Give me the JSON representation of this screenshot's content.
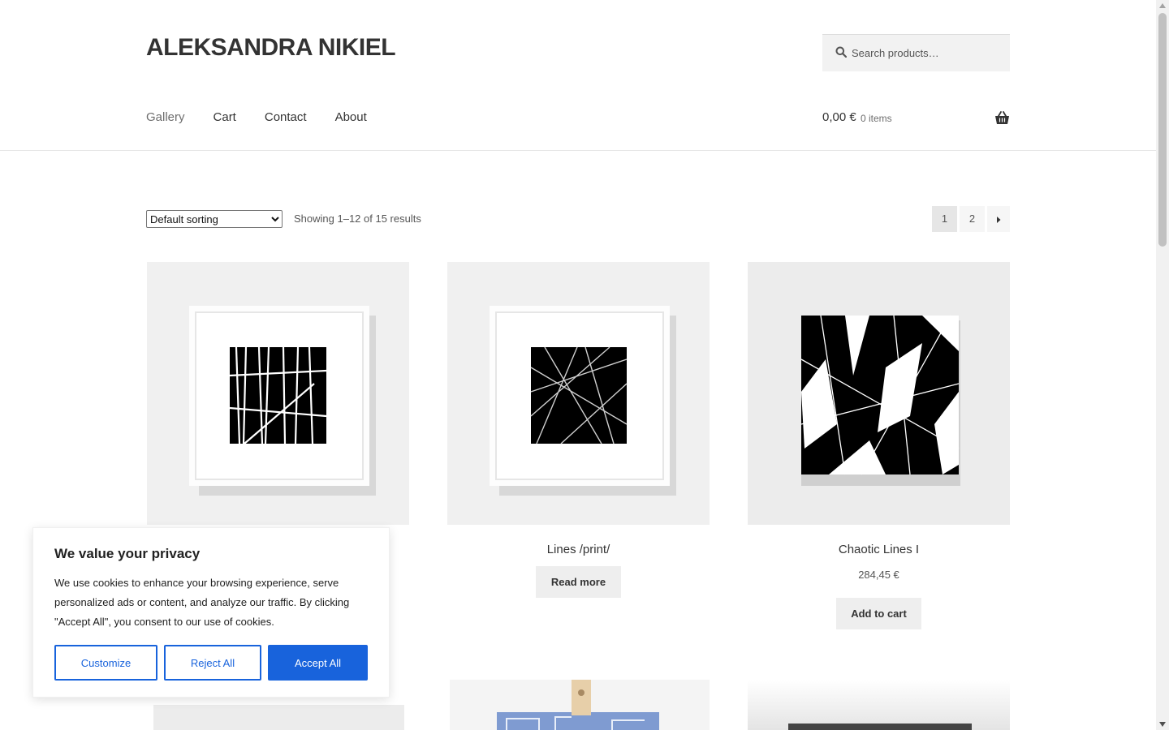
{
  "site": {
    "title": "ALEKSANDRA NIKIEL"
  },
  "search": {
    "placeholder": "Search products…",
    "icon": "search-icon"
  },
  "nav": {
    "items": [
      {
        "label": "Gallery",
        "current": true
      },
      {
        "label": "Cart",
        "current": false
      },
      {
        "label": "Contact",
        "current": false
      },
      {
        "label": "About",
        "current": false
      }
    ]
  },
  "cart": {
    "amount": "0,00 €",
    "count": "0 items",
    "icon": "basket-icon"
  },
  "toolbar": {
    "sorting": {
      "options": [
        "Default sorting"
      ],
      "selected": "Default sorting"
    },
    "result_count": "Showing 1–12 of 15 results",
    "pagination": {
      "pages": [
        "1",
        "2"
      ],
      "current": "1",
      "next_icon": "arrow-right-icon"
    }
  },
  "products": [
    {
      "title": "",
      "button": ""
    },
    {
      "title": "Lines /print/",
      "button": "Read more"
    },
    {
      "title": "Chaotic Lines I",
      "price": "284,45 €",
      "button": "Add to cart"
    }
  ],
  "cookie": {
    "title": "We value your privacy",
    "text": "We use cookies to enhance your browsing experience, serve personalized ads or content, and analyze our traffic. By clicking \"Accept All\", you consent to our use of cookies.",
    "customize": "Customize",
    "reject": "Reject All",
    "accept": "Accept All"
  },
  "colors": {
    "accent": "#1863dc",
    "text": "#333333",
    "muted": "#6d6d6d",
    "button_bg": "#eeeeee"
  }
}
